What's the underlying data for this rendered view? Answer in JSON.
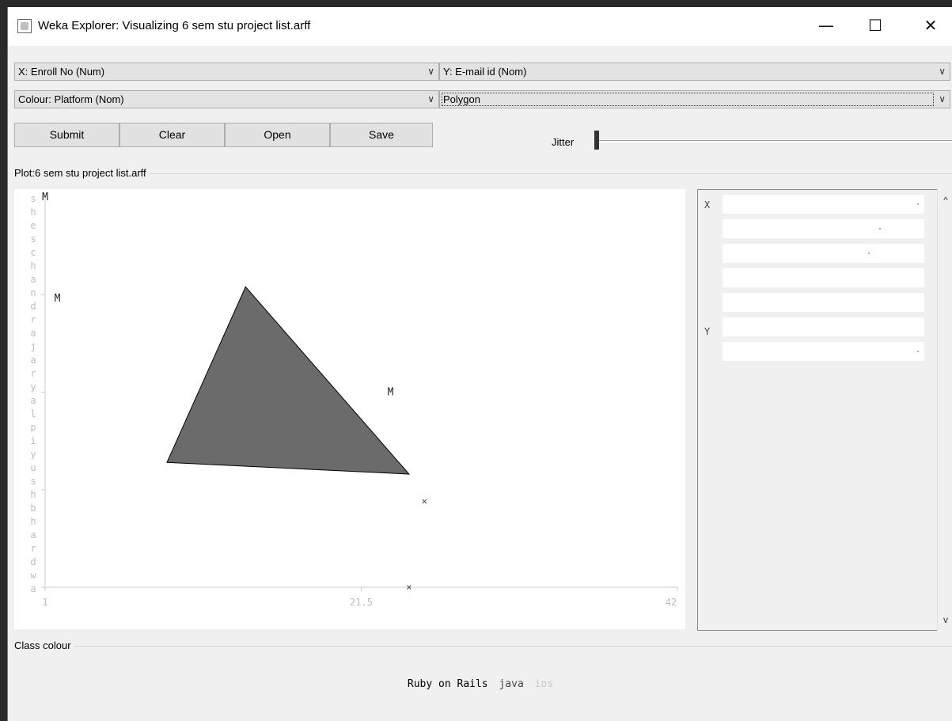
{
  "window": {
    "title": "Weka Explorer: Visualizing 6 sem stu project list.arff",
    "controls": {
      "minimize": "—",
      "maximize": "☐",
      "close": "✕"
    }
  },
  "toolbar": {
    "x_axis": "X: Enroll No (Num)",
    "y_axis": "Y: E-mail id (Nom)",
    "colour": "Colour: Platform (Nom)",
    "shape": "Polygon",
    "submit_label": "Submit",
    "clear_label": "Clear",
    "open_label": "Open",
    "save_label": "Save",
    "jitter_label": "Jitter",
    "jitter_value": 0
  },
  "plot": {
    "title": "Plot:6 sem stu project list.arff",
    "x_ticks": [
      "1",
      "21.5",
      "42"
    ],
    "y_axis_text": "sheschandrajaryalpiyushbhardwa",
    "markers": [
      "M",
      "M",
      "M"
    ]
  },
  "chart_data": {
    "type": "scatter",
    "xlabel": "Enroll No",
    "ylabel": "E-mail id",
    "xlim": [
      1,
      42
    ],
    "x_ticks": [
      "1",
      "21.5",
      "42"
    ],
    "polygon": [
      [
        14.0,
        0.77
      ],
      [
        8.9,
        0.32
      ],
      [
        24.6,
        0.29
      ]
    ],
    "points": [
      {
        "x": 1,
        "y": 1.0,
        "marker": "M"
      },
      {
        "x": 1.8,
        "y": 0.74,
        "marker": "M"
      },
      {
        "x": 23.4,
        "y": 0.5,
        "marker": "M"
      },
      {
        "x": 25.6,
        "y": 0.22,
        "marker": "×"
      },
      {
        "x": 24.6,
        "y": 0.0,
        "marker": "×"
      }
    ]
  },
  "right_panel": {
    "x_label": "X",
    "y_label": "Y",
    "scroll_up": "^",
    "scroll_down": "v"
  },
  "legend": {
    "title": "Class colour",
    "items": [
      {
        "label": "Ruby on Rails",
        "color": "#000000"
      },
      {
        "label": "java",
        "color": "#444444"
      },
      {
        "label": "ios",
        "color": "#c8c8c8"
      }
    ]
  }
}
